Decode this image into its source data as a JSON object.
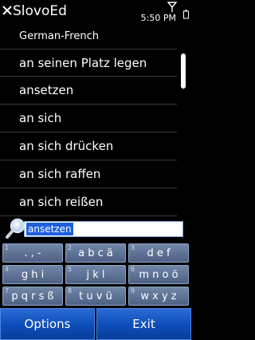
{
  "status_bar": {
    "app_title": "SlovoEd",
    "time": "5:50 PM",
    "close_icon": "close-icon",
    "signal_icon": "signal-icon",
    "battery_icon": "battery-icon"
  },
  "dictionary": {
    "name": "German-French"
  },
  "word_list": [
    "an seinen Platz legen",
    "ansetzen",
    "an sich",
    "an sich drücken",
    "an sich raffen",
    "an sich reißen"
  ],
  "search": {
    "value": "ansetzen",
    "icon": "magnifier-icon",
    "highlight_color": "#1d5fe0"
  },
  "keypad": {
    "keys": [
      {
        "number": "1",
        "label": ". , -"
      },
      {
        "number": "2",
        "label": "a b c ä"
      },
      {
        "number": "3",
        "label": "d e f"
      },
      {
        "number": "4",
        "label": "g h i"
      },
      {
        "number": "5",
        "label": "j k l"
      },
      {
        "number": "6",
        "label": "m n o ö"
      },
      {
        "number": "7",
        "label": "p q r s ß"
      },
      {
        "number": "8",
        "label": "t u v ü"
      },
      {
        "number": "9",
        "label": "w x y z"
      }
    ]
  },
  "softkeys": {
    "left": "Options",
    "right": "Exit",
    "color": "#0d4db8"
  }
}
